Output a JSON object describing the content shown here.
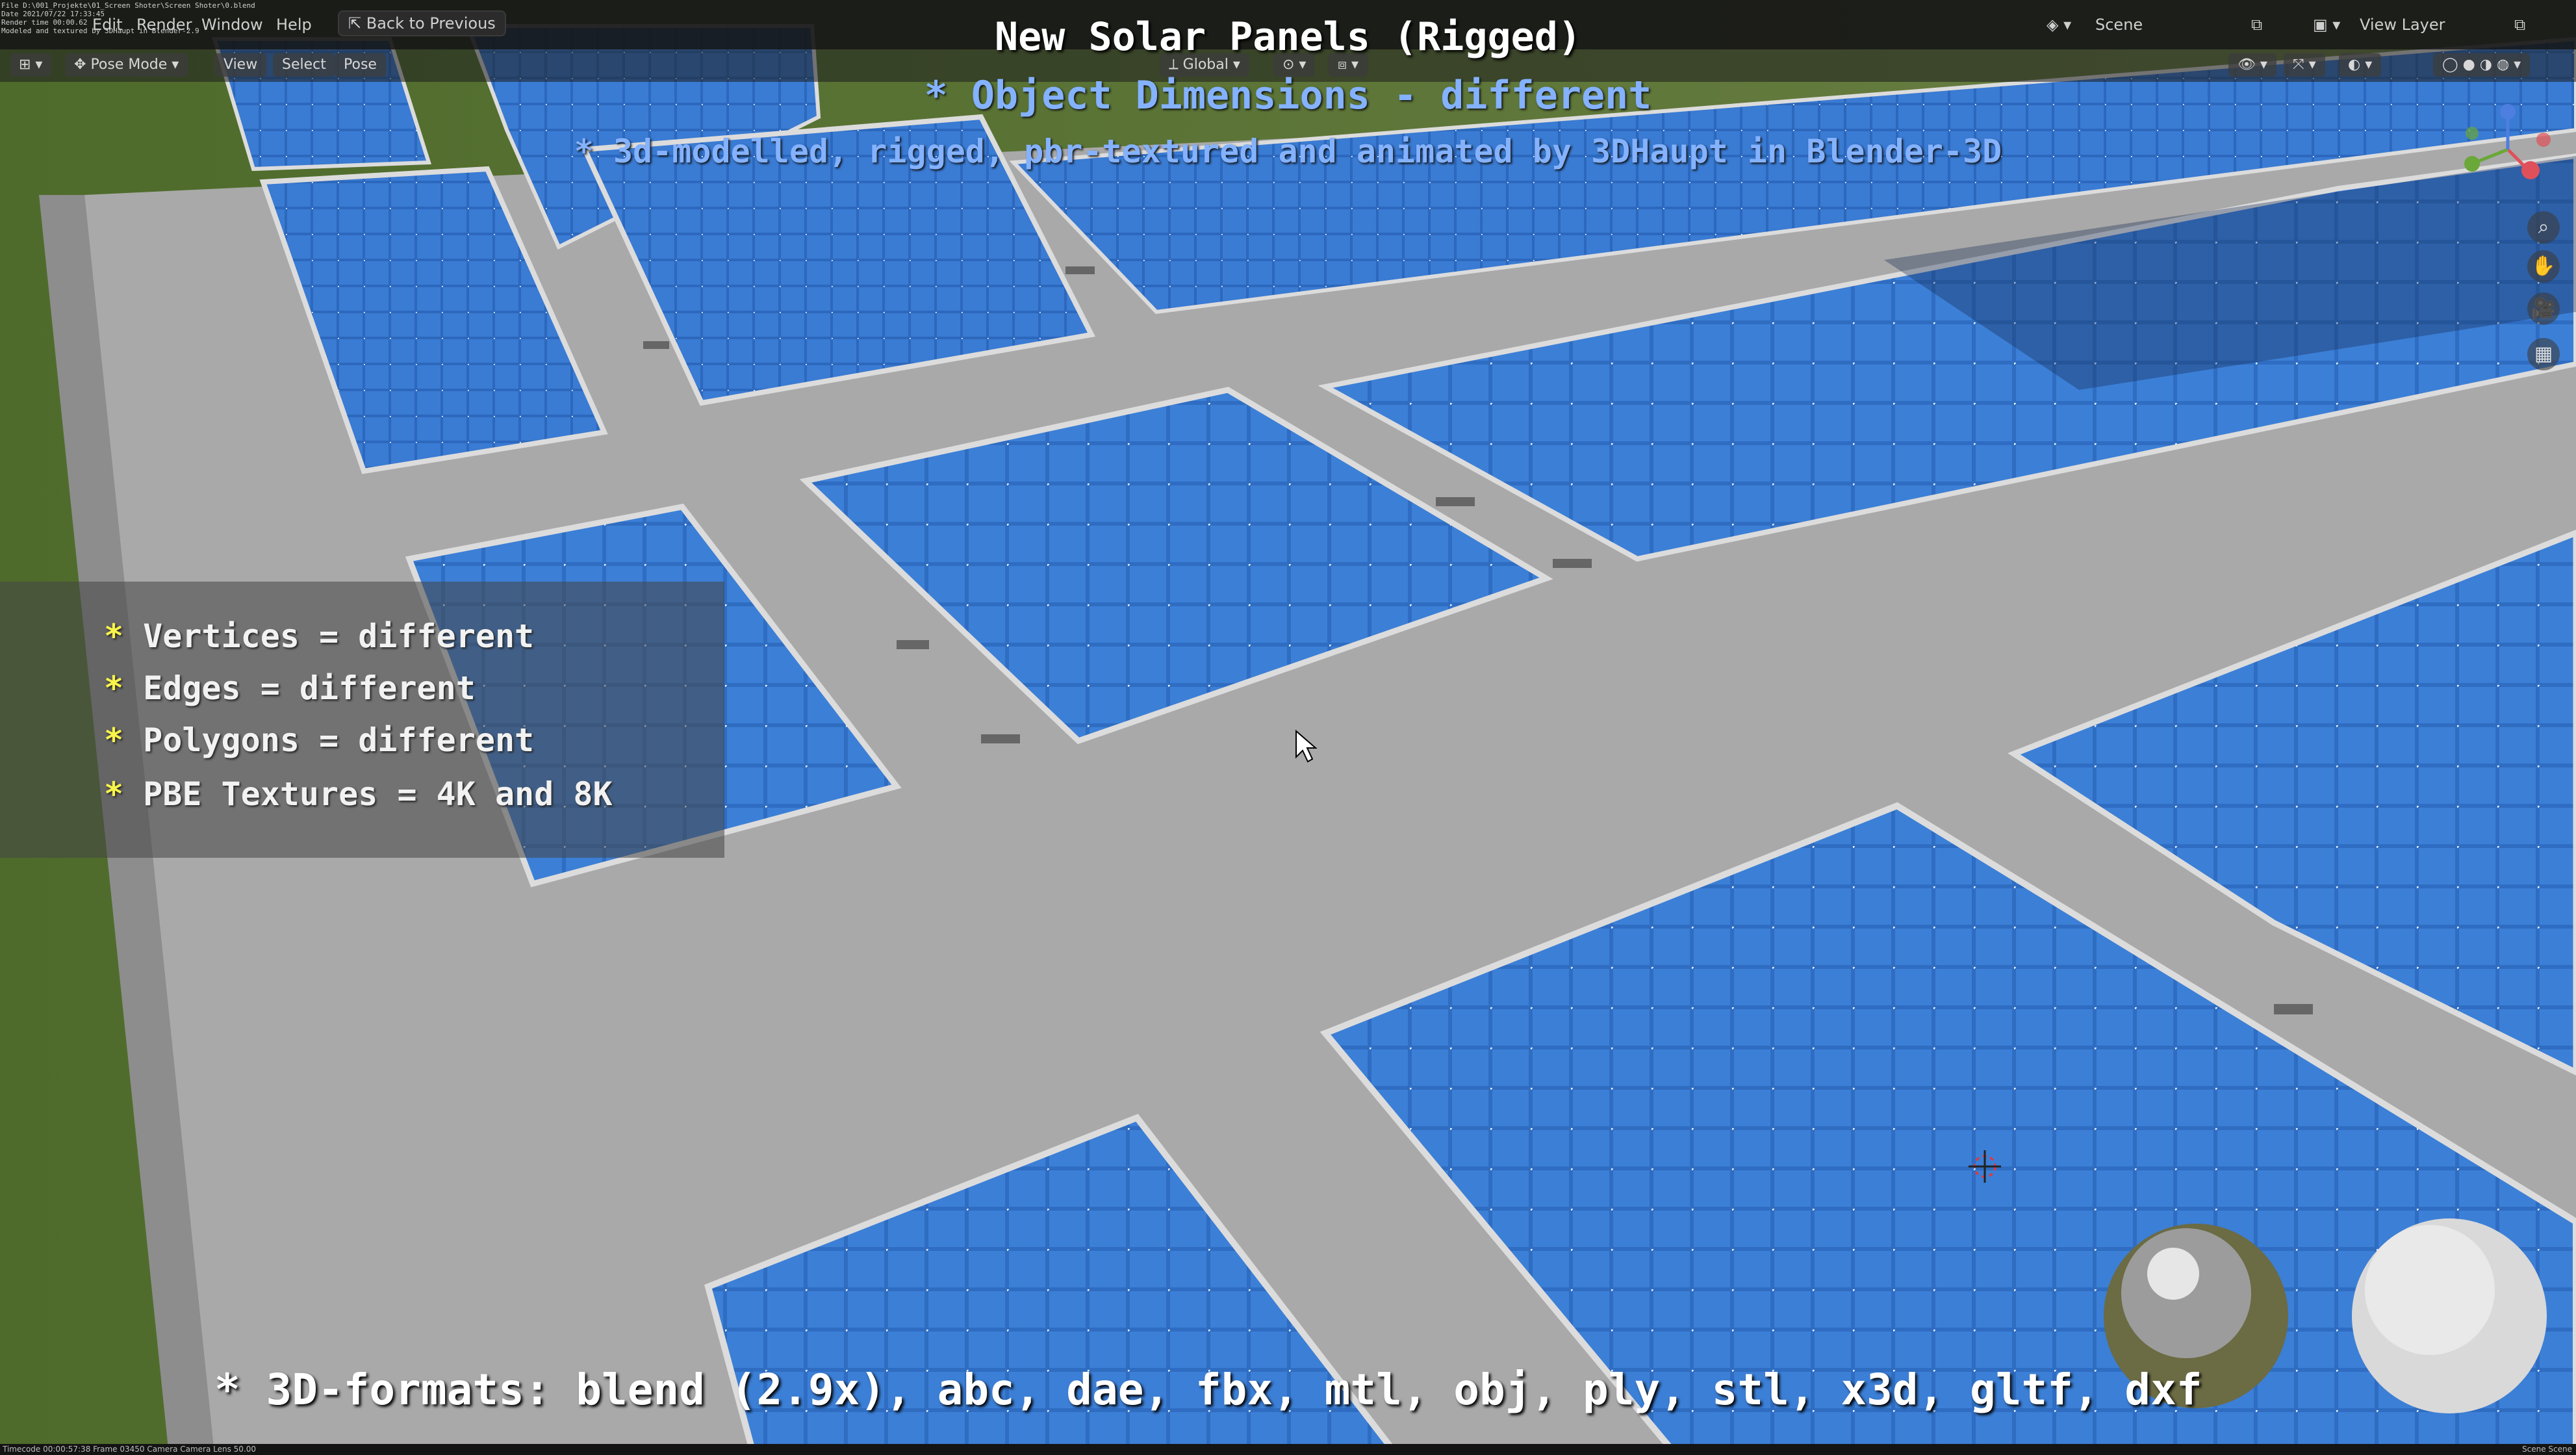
{
  "window": {
    "meta_lines": [
      "File D:\\001_Projekte\\01_Screen Shoter\\Screen Shoter\\0.blend",
      "Date 2021/07/22 17:33:45",
      "Render time 00:00.62",
      "Modeled and textured by 3DHaupt in Blender-2.9"
    ],
    "menu": [
      "Edit",
      "Render",
      "Window",
      "Help"
    ],
    "back_button": "Back to Previous",
    "scene_label": "Scene",
    "view_layer_label": "View Layer"
  },
  "header": {
    "mode": "Pose Mode",
    "view": "View",
    "select": "Select",
    "pose": "Pose",
    "orientation": "Global"
  },
  "overlay": {
    "title": "New Solar Panels (Rigged)",
    "subtitle": "* Object Dimensions -  different",
    "subtitle2": "* 3d-modelled, rigged, pbr-textured and animated by 3DHaupt in Blender-3D",
    "info": [
      {
        "star": "*",
        "text": "Vertices = different"
      },
      {
        "star": "*",
        "text": "Edges = different"
      },
      {
        "star": "*",
        "text": "Polygons = different"
      },
      {
        "star": "*",
        "text": "PBE Textures = 4K and 8K"
      }
    ],
    "formats": "* 3D-formats: blend (2.9x), abc, dae, fbx, mtl, obj, ply, stl, x3d, gltf, dxf"
  },
  "status": {
    "left": "Timecode 00:00:57:38   Frame 03450   Camera Camera   Lens 50.00",
    "right": "Scene Scene"
  },
  "icons": [
    "zoom-icon",
    "pan-hand-icon",
    "camera-icon",
    "grid-icon",
    "navigation-gizmo-icon",
    "cursor-icon"
  ],
  "colors": {
    "panel_blue": "#2f6fc4",
    "cell_blue": "#3b7ed6",
    "ground": "#a6a6a6",
    "grass": "#4f6b2a",
    "title_blue": "#84b2ff",
    "star_yellow": "#f8f44a"
  }
}
